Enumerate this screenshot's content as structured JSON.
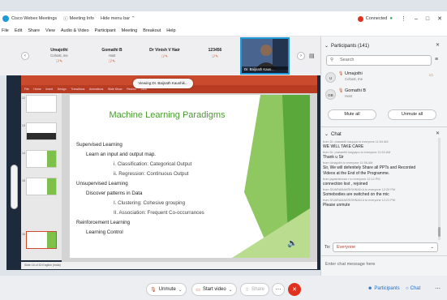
{
  "titlebar": {
    "app_name": "Cisco Webex Meetings",
    "meeting_info": "Meeting Info",
    "hide_menu_bar": "Hide menu bar",
    "connected": "Connected"
  },
  "menu": [
    "File",
    "Edit",
    "Share",
    "View",
    "Audio & Video",
    "Participant",
    "Meeting",
    "Breakout",
    "Help"
  ],
  "participants_strip": [
    {
      "name": "Umajothi",
      "sub": "Cohost, me"
    },
    {
      "name": "Gomathi B",
      "sub": "Host"
    },
    {
      "name": "Dr Vinish V Nair",
      "sub": ""
    },
    {
      "name": "123456",
      "sub": ""
    }
  ],
  "active_video": {
    "label": "Dr. Baijnath Kaus..."
  },
  "share": {
    "viewing_label": "Viewing Dr. Baijnath Kaushik...",
    "ribbon_tabs": [
      "File",
      "Home",
      "Insert",
      "Design",
      "Transitions",
      "Animations",
      "Slide Show",
      "Review",
      "View"
    ],
    "status": "Slide 16 of 30 English (India)"
  },
  "slide": {
    "title": "Machine Learning Paradigms",
    "lines": [
      "Supervised Learning",
      "Learn an input and output map.",
      "i.     Classification: Categorical Output",
      "ii.    Regression: Continuous Output",
      "Unsupervised Learning",
      "Discover patterns in Data",
      "I.     Clustering: Cohesive grouping",
      "II.    Association: Frequent Co-occurrances",
      "Reinforcement Learning",
      "Learning Control"
    ]
  },
  "thumbnails": [
    "12",
    "13",
    "14",
    "15",
    "16"
  ],
  "participants_panel": {
    "title": "Participants (141)",
    "search_placeholder": "Search",
    "people": [
      {
        "initials": "U",
        "name": "Umajothi",
        "sub": "Cohost, me"
      },
      {
        "initials": "GB",
        "name": "Gomathi B",
        "sub": "Host"
      }
    ],
    "mute_all": "Mute all",
    "unmute_all": "Unmute all"
  },
  "chat_panel": {
    "title": "Chat",
    "messages": [
      {
        "kind": "meta",
        "text": "from Dr. prasanth kauppa to everyone    11:54 AM"
      },
      {
        "kind": "text",
        "text": "WE WILL TAKE CARE"
      },
      {
        "kind": "meta",
        "text": "from Dr. prasanthi bayyapu to everyone     11:54 AM"
      },
      {
        "kind": "text",
        "text": "Thank u Sir"
      },
      {
        "kind": "meta",
        "text": "from Umajothi to everyone     11:56 AM"
      },
      {
        "kind": "text",
        "text": "Sir, We will defenitely Share all PPTs and Recorded"
      },
      {
        "kind": "text",
        "text": "Videos at the End of the Programme."
      },
      {
        "kind": "meta",
        "text": "from jayakrishnan r to everyone     12:12 PM"
      },
      {
        "kind": "text",
        "text": "connection lost , rejoined"
      },
      {
        "kind": "meta",
        "text": "from SIVARAMAKRISHNAN A to everyone     12:20 PM"
      },
      {
        "kind": "text",
        "text": "Somebodies are switched on the mic"
      },
      {
        "kind": "meta",
        "text": "from SIVARAMAKRISHNAN A to everyone     12:21 PM"
      },
      {
        "kind": "text",
        "text": "Please unmute"
      }
    ],
    "to_label": "To:",
    "to_value": "Everyone",
    "input_placeholder": "Enter chat message here"
  },
  "controls": {
    "unmute": "Unmute",
    "start_video": "Start video",
    "share": "Share",
    "participants": "Participants",
    "chat": "Chat"
  },
  "colors": {
    "accent_blue": "#1f9ad6",
    "end_red": "#e0301e",
    "ppt_red": "#c94a2c",
    "slide_green": "#4a9b2f"
  }
}
